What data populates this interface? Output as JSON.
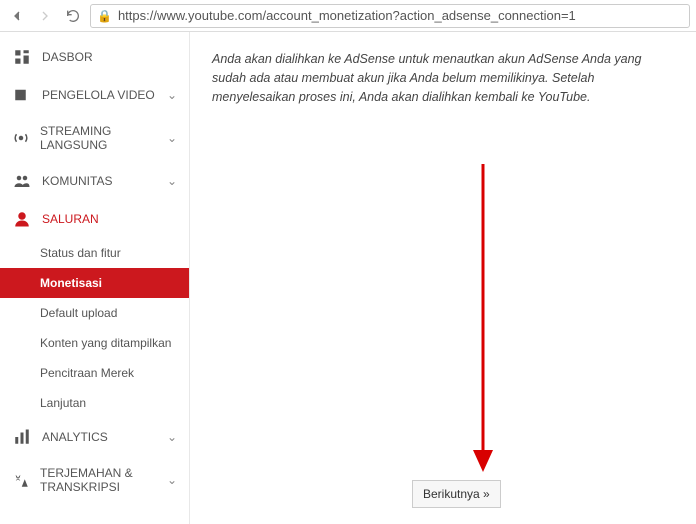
{
  "browser": {
    "url": "https://www.youtube.com/account_monetization?action_adsense_connection=1"
  },
  "sidebar": {
    "items": [
      {
        "label": "DASBOR"
      },
      {
        "label": "PENGELOLA VIDEO"
      },
      {
        "label": "STREAMING LANGSUNG"
      },
      {
        "label": "KOMUNITAS"
      },
      {
        "label": "SALURAN"
      },
      {
        "label": "ANALYTICS"
      },
      {
        "label": "TERJEMAHAN & TRANSKRIPSI"
      }
    ],
    "saluran_sub": [
      {
        "label": "Status dan fitur"
      },
      {
        "label": "Monetisasi"
      },
      {
        "label": "Default upload"
      },
      {
        "label": "Konten yang ditampilkan"
      },
      {
        "label": "Pencitraan Merek"
      },
      {
        "label": "Lanjutan"
      }
    ]
  },
  "content": {
    "message": "Anda akan dialihkan ke AdSense untuk menautkan akun AdSense Anda yang sudah ada atau membuat akun jika Anda belum memilikinya. Setelah menyelesaikan proses ini, Anda akan dialihkan kembali ke YouTube.",
    "next_button": "Berikutnya »"
  }
}
